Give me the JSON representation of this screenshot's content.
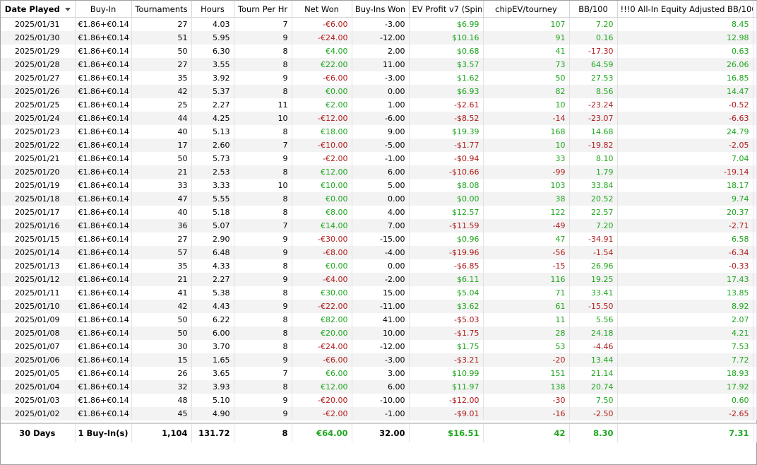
{
  "columns": [
    {
      "key": "date",
      "label": "Date Played",
      "align": "c",
      "width": 105,
      "sorted": true
    },
    {
      "key": "buyin",
      "label": "Buy-In",
      "align": "c",
      "width": 80
    },
    {
      "key": "tourn",
      "label": "Tournaments",
      "align": "r",
      "width": 85
    },
    {
      "key": "hours",
      "label": "Hours",
      "align": "r",
      "width": 60
    },
    {
      "key": "tph",
      "label": "Tourn Per Hr",
      "align": "r",
      "width": 82
    },
    {
      "key": "net",
      "label": "Net Won",
      "align": "r",
      "width": 85,
      "colored": true
    },
    {
      "key": "biw",
      "label": "Buy-Ins Won",
      "align": "r",
      "width": 81
    },
    {
      "key": "ev",
      "label": "EV Profit v7 (Spin)",
      "align": "r",
      "width": 105,
      "colored": true
    },
    {
      "key": "chip",
      "label": "chipEV/tourney",
      "align": "r",
      "width": 122,
      "colored": true
    },
    {
      "key": "bb",
      "label": "BB/100",
      "align": "r",
      "width": 68,
      "colored": true
    },
    {
      "key": "aie",
      "label": "!!!0 All-In Equity Adjusted BB/100",
      "align": "r",
      "width": 192,
      "colored": true
    },
    {
      "key": "pad",
      "label": "",
      "align": "r",
      "width": 5
    }
  ],
  "rows": [
    [
      "2025/01/31",
      "€1.86+€0.14",
      "27",
      "4.03",
      "7",
      "-€6.00",
      "-3.00",
      "$6.99",
      "107",
      "7.20",
      "8.45"
    ],
    [
      "2025/01/30",
      "€1.86+€0.14",
      "51",
      "5.95",
      "9",
      "-€24.00",
      "-12.00",
      "$10.16",
      "91",
      "0.16",
      "12.98"
    ],
    [
      "2025/01/29",
      "€1.86+€0.14",
      "50",
      "6.30",
      "8",
      "€4.00",
      "2.00",
      "$0.68",
      "41",
      "-17.30",
      "0.63"
    ],
    [
      "2025/01/28",
      "€1.86+€0.14",
      "27",
      "3.55",
      "8",
      "€22.00",
      "11.00",
      "$3.57",
      "73",
      "64.59",
      "26.06"
    ],
    [
      "2025/01/27",
      "€1.86+€0.14",
      "35",
      "3.92",
      "9",
      "-€6.00",
      "-3.00",
      "$1.62",
      "50",
      "27.53",
      "16.85"
    ],
    [
      "2025/01/26",
      "€1.86+€0.14",
      "42",
      "5.37",
      "8",
      "€0.00",
      "0.00",
      "$6.93",
      "82",
      "8.56",
      "14.47"
    ],
    [
      "2025/01/25",
      "€1.86+€0.14",
      "25",
      "2.27",
      "11",
      "€2.00",
      "1.00",
      "-$2.61",
      "10",
      "-23.24",
      "-0.52"
    ],
    [
      "2025/01/24",
      "€1.86+€0.14",
      "44",
      "4.25",
      "10",
      "-€12.00",
      "-6.00",
      "-$8.52",
      "-14",
      "-23.07",
      "-6.63"
    ],
    [
      "2025/01/23",
      "€1.86+€0.14",
      "40",
      "5.13",
      "8",
      "€18.00",
      "9.00",
      "$19.39",
      "168",
      "14.68",
      "24.79"
    ],
    [
      "2025/01/22",
      "€1.86+€0.14",
      "17",
      "2.60",
      "7",
      "-€10.00",
      "-5.00",
      "-$1.77",
      "10",
      "-19.82",
      "-2.05"
    ],
    [
      "2025/01/21",
      "€1.86+€0.14",
      "50",
      "5.73",
      "9",
      "-€2.00",
      "-1.00",
      "-$0.94",
      "33",
      "8.10",
      "7.04"
    ],
    [
      "2025/01/20",
      "€1.86+€0.14",
      "21",
      "2.53",
      "8",
      "€12.00",
      "6.00",
      "-$10.66",
      "-99",
      "1.79",
      "-19.14"
    ],
    [
      "2025/01/19",
      "€1.86+€0.14",
      "33",
      "3.33",
      "10",
      "€10.00",
      "5.00",
      "$8.08",
      "103",
      "33.84",
      "18.17"
    ],
    [
      "2025/01/18",
      "€1.86+€0.14",
      "47",
      "5.55",
      "8",
      "€0.00",
      "0.00",
      "$0.00",
      "38",
      "20.52",
      "9.74"
    ],
    [
      "2025/01/17",
      "€1.86+€0.14",
      "40",
      "5.18",
      "8",
      "€8.00",
      "4.00",
      "$12.57",
      "122",
      "22.57",
      "20.37"
    ],
    [
      "2025/01/16",
      "€1.86+€0.14",
      "36",
      "5.07",
      "7",
      "€14.00",
      "7.00",
      "-$11.59",
      "-49",
      "7.20",
      "-2.71"
    ],
    [
      "2025/01/15",
      "€1.86+€0.14",
      "27",
      "2.90",
      "9",
      "-€30.00",
      "-15.00",
      "$0.96",
      "47",
      "-34.91",
      "6.58"
    ],
    [
      "2025/01/14",
      "€1.86+€0.14",
      "57",
      "6.48",
      "9",
      "-€8.00",
      "-4.00",
      "-$19.96",
      "-56",
      "-1.54",
      "-6.34"
    ],
    [
      "2025/01/13",
      "€1.86+€0.14",
      "35",
      "4.33",
      "8",
      "€0.00",
      "0.00",
      "-$6.85",
      "-15",
      "26.96",
      "-0.33"
    ],
    [
      "2025/01/12",
      "€1.86+€0.14",
      "21",
      "2.27",
      "9",
      "-€4.00",
      "-2.00",
      "$6.11",
      "116",
      "19.25",
      "17.43"
    ],
    [
      "2025/01/11",
      "€1.86+€0.14",
      "41",
      "5.38",
      "8",
      "€30.00",
      "15.00",
      "$5.04",
      "71",
      "33.41",
      "13.85"
    ],
    [
      "2025/01/10",
      "€1.86+€0.14",
      "42",
      "4.43",
      "9",
      "-€22.00",
      "-11.00",
      "$3.62",
      "61",
      "-15.50",
      "8.92"
    ],
    [
      "2025/01/09",
      "€1.86+€0.14",
      "50",
      "6.22",
      "8",
      "€82.00",
      "41.00",
      "-$5.03",
      "11",
      "5.56",
      "2.07"
    ],
    [
      "2025/01/08",
      "€1.86+€0.14",
      "50",
      "6.00",
      "8",
      "€20.00",
      "10.00",
      "-$1.75",
      "28",
      "24.18",
      "4.21"
    ],
    [
      "2025/01/07",
      "€1.86+€0.14",
      "30",
      "3.70",
      "8",
      "-€24.00",
      "-12.00",
      "$1.75",
      "53",
      "-4.46",
      "7.53"
    ],
    [
      "2025/01/06",
      "€1.86+€0.14",
      "15",
      "1.65",
      "9",
      "-€6.00",
      "-3.00",
      "-$3.21",
      "-20",
      "13.44",
      "7.72"
    ],
    [
      "2025/01/05",
      "€1.86+€0.14",
      "26",
      "3.65",
      "7",
      "€6.00",
      "3.00",
      "$10.99",
      "151",
      "21.14",
      "18.93"
    ],
    [
      "2025/01/04",
      "€1.86+€0.14",
      "32",
      "3.93",
      "8",
      "€12.00",
      "6.00",
      "$11.97",
      "138",
      "20.74",
      "17.92"
    ],
    [
      "2025/01/03",
      "€1.86+€0.14",
      "48",
      "5.10",
      "9",
      "-€20.00",
      "-10.00",
      "-$12.00",
      "-30",
      "7.50",
      "0.60"
    ],
    [
      "2025/01/02",
      "€1.86+€0.14",
      "45",
      "4.90",
      "9",
      "-€2.00",
      "-1.00",
      "-$9.01",
      "-16",
      "-2.50",
      "-2.65"
    ]
  ],
  "totals": [
    "30 Days",
    "1 Buy-In(s)",
    "1,104",
    "131.72",
    "8",
    "€64.00",
    "32.00",
    "$16.51",
    "42",
    "8.30",
    "7.31"
  ],
  "colors": {
    "positive": "#1fa51f",
    "negative": "#b01c1c",
    "stripe": "#f3f3f3"
  },
  "sort_icon": "chevron-down-icon"
}
